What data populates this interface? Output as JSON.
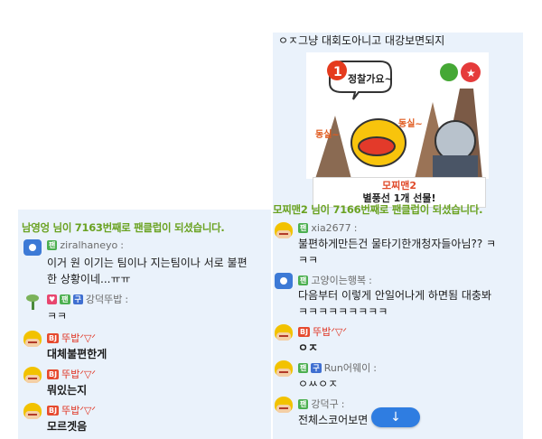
{
  "left": {
    "system_message": "남영엉 님이 7163번째로 팬클럽이 되셨습니다.",
    "messages": [
      {
        "badges": [
          "팬"
        ],
        "name": "ziralhaneyo",
        "lines": [
          "이거 원 이기는 팀이나 지는팀이나 서로 불편",
          "한 상황이네...ㅠㅠ"
        ]
      },
      {
        "badges": [
          "♥",
          "팬",
          "구"
        ],
        "name": "강덕뚜밥",
        "lines": [
          "ㅋㅋ"
        ]
      },
      {
        "badges": [
          "BJ"
        ],
        "name": "뚜밥ᐟ▽ᐟ",
        "lines": [
          "대체불편한게"
        ]
      },
      {
        "badges": [
          "BJ"
        ],
        "name": "뚜밥ᐟ▽ᐟ",
        "lines": [
          "뭐있는지"
        ]
      },
      {
        "badges": [
          "BJ"
        ],
        "name": "뚜밥ᐟ▽ᐟ",
        "lines": [
          "모르겟음"
        ]
      }
    ]
  },
  "right": {
    "top_message": "ㅇㅈ그냥 대회도아니고 대강보면되지",
    "gift": {
      "sticker_text_1": "정찰가요~",
      "sticker_text_2": "동실~",
      "sticker_text_3": "동실~",
      "name": "모찌맨2",
      "message": "별풍선 1개 선물!"
    },
    "system_message": "모찌맨2 님이 7166번째로 팬클럽이 되셨습니다.",
    "messages": [
      {
        "badges": [
          "팬"
        ],
        "name": "xia2677",
        "lines": [
          "불편하게만든건 물타기한개청자들아님?? ㅋ",
          "ㅋㅋ"
        ]
      },
      {
        "badges": [
          "팬"
        ],
        "name": "고양이는행복",
        "lines": [
          "다음부터 이렇게 안일어나게 하면됨 대충봐",
          "ㅋㅋㅋㅋㅋㅋㅋㅋㅋ"
        ]
      },
      {
        "badges": [
          "BJ"
        ],
        "name": "뚜밥ᐟ▽ᐟ",
        "lines": [
          "ㅇㅈ"
        ]
      },
      {
        "badges": [
          "팬",
          "구"
        ],
        "name": "Run어웨이",
        "lines": [
          "ㅇㅆㅇㅈ"
        ]
      },
      {
        "badges": [
          "팬"
        ],
        "name": "강덕구",
        "lines": [
          "전체스코어보면"
        ]
      }
    ],
    "scroll_button_icon": "arrow-down-icon"
  }
}
